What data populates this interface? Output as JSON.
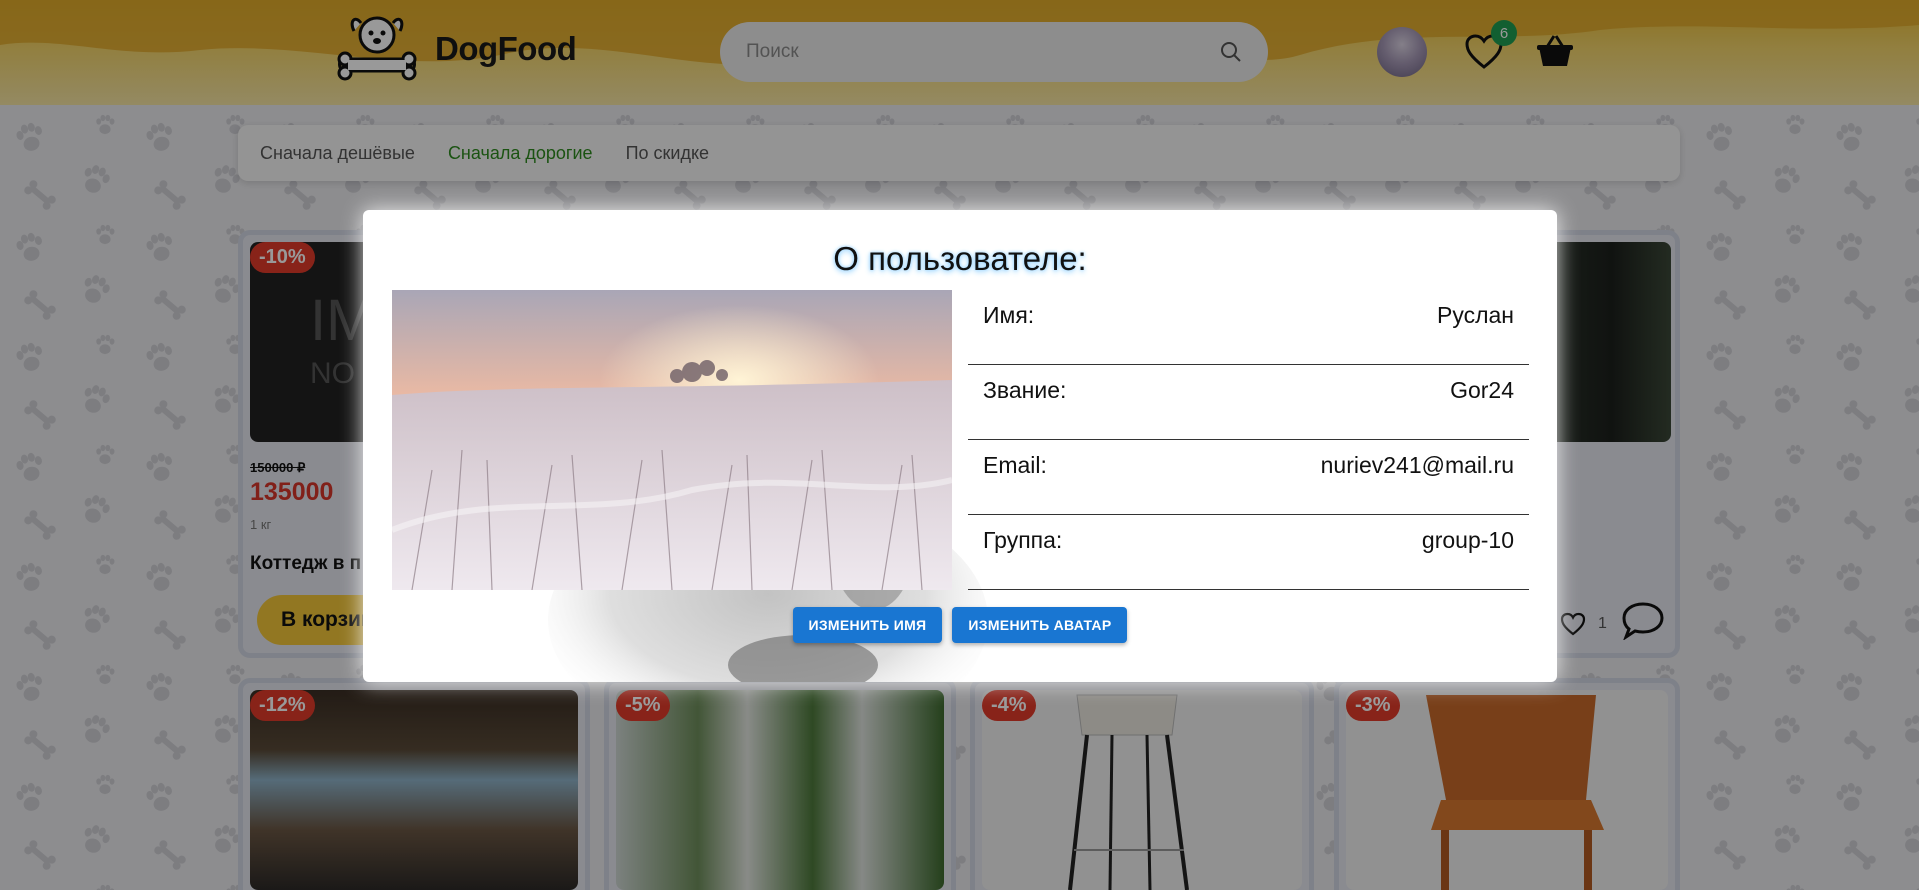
{
  "header": {
    "logo_text": "DogFood",
    "search": {
      "placeholder": "Поиск"
    },
    "favorites_count": "6",
    "icons": {
      "logo": "dog-bone-icon",
      "search": "search-icon",
      "favorites": "heart-icon",
      "cart": "basket-icon",
      "avatar": "user-avatar"
    }
  },
  "sort": {
    "options": [
      "Сначала дешёвые",
      "Сначала дорогие",
      "По скидке"
    ],
    "active": "Сначала дорогие"
  },
  "products": [
    {
      "discount": "-10%",
      "old_price": "150000 ₽",
      "price": "135000",
      "weight": "1 кг",
      "name": "Коттедж в п",
      "cart_label": "В корзин",
      "likes": "1",
      "image_text": "IM",
      "image_text_sub": "NO"
    },
    {
      "discount": "-12%"
    },
    {
      "discount": "-5%"
    },
    {
      "discount": "-4%"
    },
    {
      "discount": "-3%"
    }
  ],
  "modal": {
    "title": "О пользователе:",
    "fields": [
      {
        "label": "Имя:",
        "value": "Руслан"
      },
      {
        "label": "Звание:",
        "value": "Gor24"
      },
      {
        "label": "Email:",
        "value": "nuriev241@mail.ru"
      },
      {
        "label": "Группа:",
        "value": "group-10"
      }
    ],
    "buttons": {
      "change_name": "Изменить имя",
      "change_avatar": "Изменить аватар"
    }
  },
  "colors": {
    "accent_yellow": "#f3c73a",
    "discount_red": "#e33b2b",
    "active_sort": "#2e8b1f",
    "button_blue": "#1976d2",
    "badge_green": "#1e9e52"
  }
}
